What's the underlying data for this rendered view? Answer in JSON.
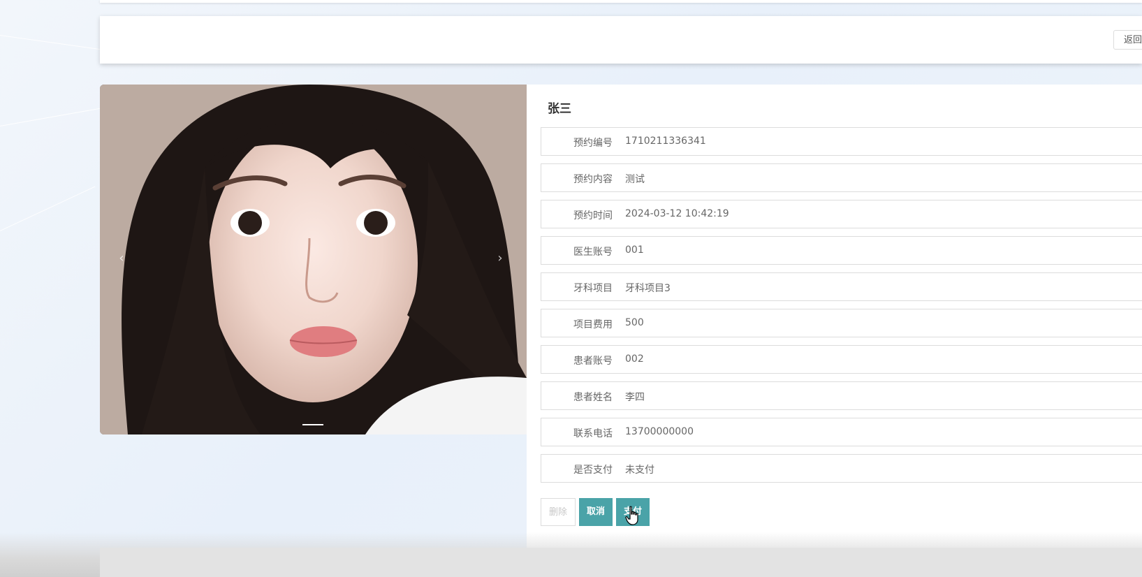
{
  "header": {
    "back_label": "返回"
  },
  "carousel": {
    "prev_glyph": "‹",
    "next_glyph": "›",
    "active_slide": 1,
    "slide_count": 1
  },
  "detail": {
    "name": "张三",
    "fields": [
      {
        "label": "预约编号",
        "value": "1710211336341"
      },
      {
        "label": "预约内容",
        "value": "测试"
      },
      {
        "label": "预约时间",
        "value": "2024-03-12 10:42:19"
      },
      {
        "label": "医生账号",
        "value": "001"
      },
      {
        "label": "牙科项目",
        "value": "牙科项目3"
      },
      {
        "label": "项目费用",
        "value": "500"
      },
      {
        "label": "患者账号",
        "value": "002"
      },
      {
        "label": "患者姓名",
        "value": "李四"
      },
      {
        "label": "联系电话",
        "value": "13700000000"
      },
      {
        "label": "是否支付",
        "value": "未支付"
      }
    ]
  },
  "actions": {
    "delete_label": "删除",
    "cancel_label": "取消",
    "pay_label": "支付"
  },
  "colors": {
    "accent": "#4aa3a8"
  }
}
